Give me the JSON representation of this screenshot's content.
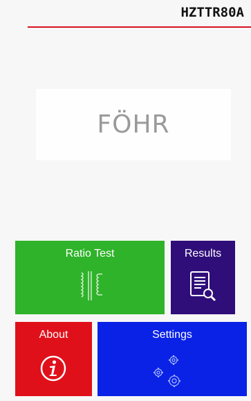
{
  "header": {
    "title": "HZTTR80A"
  },
  "brand": {
    "logo": "FÖHR"
  },
  "tiles": {
    "ratio_test": {
      "label": "Ratio Test",
      "icon": "transformer-icon",
      "color": "#2fb32a"
    },
    "results": {
      "label": "Results",
      "icon": "document-search-icon",
      "color": "#2f0e7a"
    },
    "about": {
      "label": "About",
      "icon": "info-icon",
      "color": "#e0101b"
    },
    "settings": {
      "label": "Settings",
      "icon": "gears-icon",
      "color": "#0a22e6"
    }
  },
  "colors": {
    "accent_line": "#d8111f",
    "background": "#f7f7f7"
  }
}
